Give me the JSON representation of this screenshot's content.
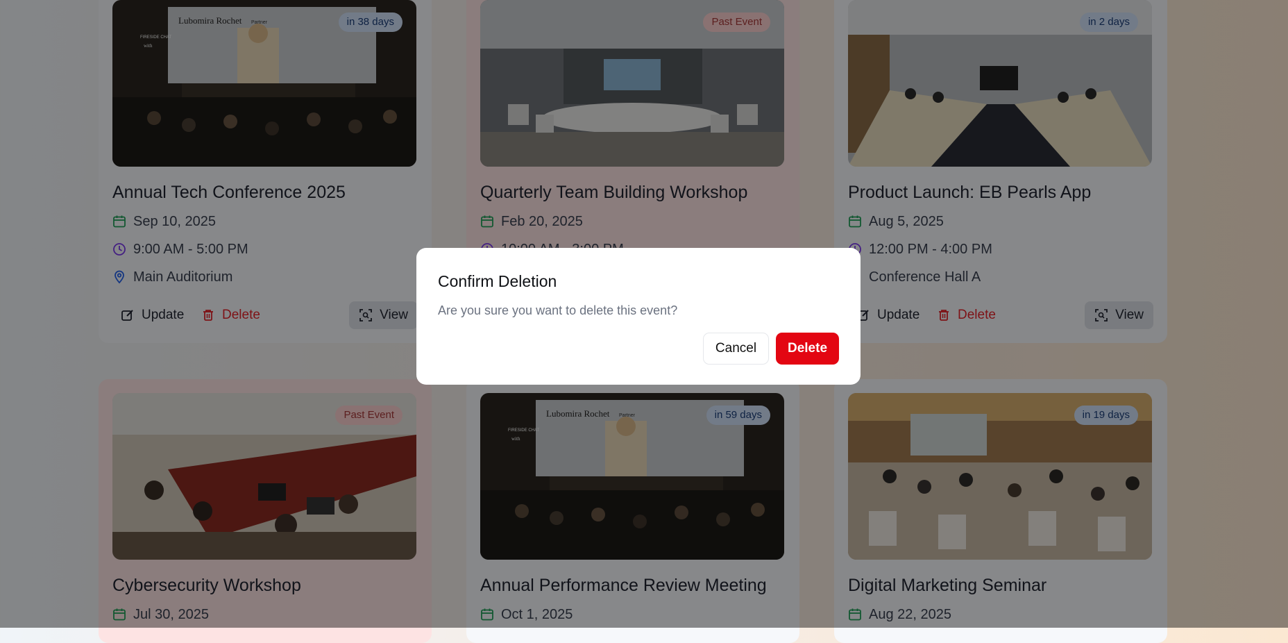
{
  "events": [
    {
      "title": "Annual Tech Conference 2025",
      "date": "Sep 10, 2025",
      "time": "9:00 AM - 5:00 PM",
      "location": "Main Auditorium",
      "badge": "in 38 days",
      "status": "future"
    },
    {
      "title": "Quarterly Team Building Workshop",
      "date": "Feb 20, 2025",
      "time": "10:00 AM - 3:00 PM",
      "location": "",
      "badge": "Past Event",
      "status": "past"
    },
    {
      "title": "Product Launch: EB Pearls App",
      "date": "Aug 5, 2025",
      "time": "12:00 PM - 4:00 PM",
      "location": "Conference Hall A",
      "badge": "in 2 days",
      "status": "future"
    },
    {
      "title": "Cybersecurity Workshop",
      "date": "Jul 30, 2025",
      "badge": "Past Event",
      "status": "past"
    },
    {
      "title": "Annual Performance Review Meeting",
      "date": "Oct 1, 2025",
      "badge": "in 59 days",
      "status": "future"
    },
    {
      "title": "Digital Marketing Seminar",
      "date": "Aug 22, 2025",
      "badge": "in 19 days",
      "status": "future"
    }
  ],
  "actions": {
    "update": "Update",
    "delete": "Delete",
    "view": "View"
  },
  "photo_text": {
    "speaker": "Lubomira Rochet",
    "speaker_role": "Partner",
    "session": "FIRESIDE CHAT",
    "with": "with"
  },
  "modal": {
    "title": "Confirm Deletion",
    "message": "Are you sure you want to delete this event?",
    "cancel": "Cancel",
    "confirm": "Delete"
  },
  "colors": {
    "accent_red": "#e30612",
    "future_badge": "#cfe0f7",
    "past_badge": "#fbd0d0",
    "calendar_icon": "#22a05a",
    "clock_icon": "#7c3aed",
    "pin_icon": "#2563eb"
  }
}
